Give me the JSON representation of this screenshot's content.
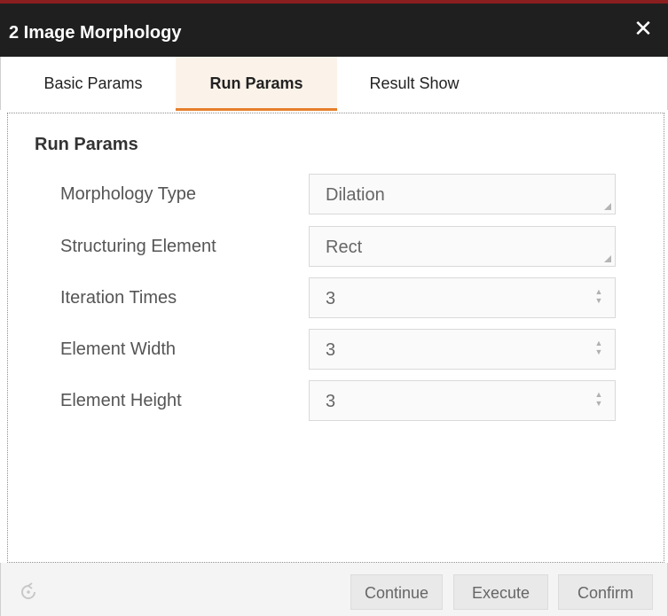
{
  "window": {
    "title": "2 Image Morphology"
  },
  "tabs": [
    {
      "label": "Basic Params"
    },
    {
      "label": "Run Params"
    },
    {
      "label": "Result Show"
    }
  ],
  "active_tab": "Run Params",
  "section": {
    "title": "Run Params"
  },
  "params": [
    {
      "label": "Morphology Type",
      "value": "Dilation",
      "control": "select"
    },
    {
      "label": "Structuring Element",
      "value": "Rect",
      "control": "select"
    },
    {
      "label": "Iteration Times",
      "value": "3",
      "control": "spinner"
    },
    {
      "label": "Element Width",
      "value": "3",
      "control": "spinner"
    },
    {
      "label": "Element Height",
      "value": "3",
      "control": "spinner"
    }
  ],
  "footer": {
    "icons": {
      "refresh": "refresh-icon"
    },
    "buttons": {
      "continue": "Continue",
      "execute": "Execute",
      "confirm": "Confirm"
    }
  },
  "icons": {
    "close": "close-icon"
  },
  "colors": {
    "titlebar": "#1f1f1f",
    "titlebar_top_border": "#8b1e1e",
    "active_tab_underline": "#e57f2b",
    "active_tab_bg": "#fbf3ea"
  }
}
